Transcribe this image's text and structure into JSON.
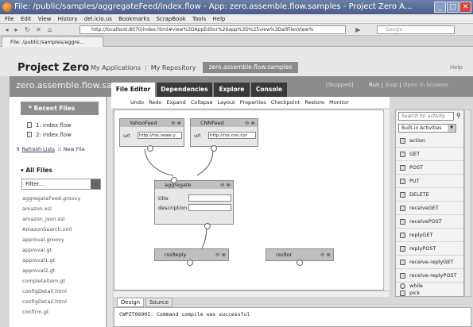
{
  "window": {
    "title": "File: /public/samples/aggregateFeed/index.flow - App: zero.assemble.flow.samples - Project Zero A..."
  },
  "menubar": [
    "File",
    "Edit",
    "View",
    "History",
    "del.icio.us",
    "Bookmarks",
    "ScrapBook",
    "Tools",
    "Help"
  ],
  "navbar": {
    "url": "http://localhost:8070/index.html#view%3DAppEditor%26app%3D%25view%3DallFilesView%",
    "search_placeholder": "Google"
  },
  "browser_tab": {
    "label": "File: /public/samples/aggre..."
  },
  "header": {
    "project": "Project Zero",
    "nav": [
      "My Applications",
      "My Repository"
    ],
    "active_app": "zero.assemble.flow.samples",
    "help": "Help"
  },
  "band": {
    "app_name": "zero.assemble.flow.sa",
    "tabs": [
      "File Editor",
      "Dependencies",
      "Explore",
      "Console"
    ],
    "status": "[Stopped]",
    "run": "Run",
    "stop": "Stop",
    "open": "Open in browser"
  },
  "sidebar": {
    "recent_title": "* Recent Files",
    "recent": [
      "1: index.flow",
      "2: index.flow"
    ],
    "refresh": "Refresh Lists",
    "new_file": "New File",
    "all_title": "▾ All Files",
    "filter_placeholder": "Filter...",
    "files": [
      "aggregateFeed.groovy",
      "amazon.xsl",
      "amazon_json.xsl",
      "AmazonSearch.xml",
      "approval.groovy",
      "approval.gt",
      "approval1.gt",
      "approval2.gt",
      "completeItem.gt",
      "configDetail.html",
      "configDetail.html",
      "confirm.gt"
    ]
  },
  "toolbar": [
    "Undo",
    "Redo",
    "Expand",
    "Collapse",
    "Layout",
    "Properties",
    "Checkpoint",
    "Restore",
    "Monitor"
  ],
  "nodes": {
    "yahoo": {
      "title": "YahooFeed",
      "field_label": "url",
      "field_value": "http://rss.news.y"
    },
    "cnn": {
      "title": "CNNFeed",
      "field_label": "url",
      "field_value": "http://rss.cnn.cor"
    },
    "aggregate": {
      "title": "aggregate",
      "field1_label": "title",
      "field2_label": "description"
    },
    "reply": {
      "title": "rssReply"
    },
    "rssror": {
      "title": "rssRor"
    },
    "controls": "⊖ ⊗"
  },
  "palette": {
    "search_placeholder": "Search for activity",
    "dropdown": "Built-in Activities",
    "items": [
      "action",
      "GET",
      "POST",
      "PUT",
      "DELETE",
      "receiveGET",
      "receivePOST",
      "replyGET",
      "replyPOST",
      "receive-replyGET",
      "receive-replyPOST",
      "while",
      "pick"
    ]
  },
  "bottom_tabs": [
    "Design",
    "Source"
  ],
  "console": {
    "message": "CWPZT0600I: Command compile was successful"
  }
}
